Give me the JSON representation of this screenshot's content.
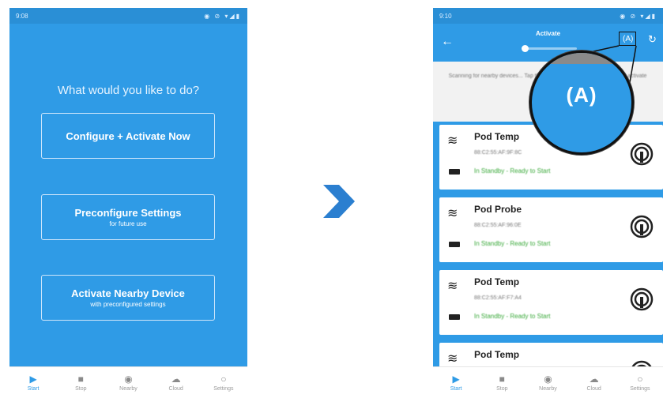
{
  "left_screen": {
    "status_time": "9:08",
    "status_icons": "◉ ⊘ ▾◢▮",
    "prompt": "What would you like to do?",
    "buttons": [
      {
        "label": "Configure + Activate Now",
        "sublabel": ""
      },
      {
        "label": "Preconfigure Settings",
        "sublabel": "for future use"
      },
      {
        "label": "Activate Nearby Device",
        "sublabel": "with preconfigured settings"
      }
    ]
  },
  "bottom_nav": [
    {
      "label": "Start",
      "icon": "play-icon",
      "glyph": "▶",
      "active": true
    },
    {
      "label": "Stop",
      "icon": "stop-icon",
      "glyph": "■",
      "active": false
    },
    {
      "label": "Nearby",
      "icon": "nearby-icon",
      "glyph": "◉",
      "active": false
    },
    {
      "label": "Cloud",
      "icon": "cloud-icon",
      "glyph": "☁",
      "active": false
    },
    {
      "label": "Settings",
      "icon": "settings-icon",
      "glyph": "○",
      "active": false
    }
  ],
  "right_screen": {
    "status_time": "9:10",
    "status_icons": "◉ ⊘ ▾◢▮",
    "title": "Activate",
    "scan_text": "Scanning for nearby devices... Tap the auto-use button on your device to activate with ...",
    "toolbar_auto_icon": "auto-activate-icon",
    "toolbar_refresh_icon": "refresh-icon",
    "devices": [
      {
        "name": "Pod Temp",
        "mac": "88:C2:55:AF:9F:8C",
        "status": "In Standby - Ready to Start"
      },
      {
        "name": "Pod Probe",
        "mac": "88:C2:55:AF:96:0E",
        "status": "In Standby - Ready to Start"
      },
      {
        "name": "Pod Temp",
        "mac": "88:C2:55:AF:F7:A4",
        "status": "In Standby - Ready to Start"
      },
      {
        "name": "Pod Temp",
        "mac": "",
        "status": ""
      }
    ],
    "magnifier_icon_text": "(A)"
  },
  "colors": {
    "primary_blue": "#2f9be6",
    "status_green": "#3aa93a",
    "arrow_blue": "#2b7fd0"
  }
}
